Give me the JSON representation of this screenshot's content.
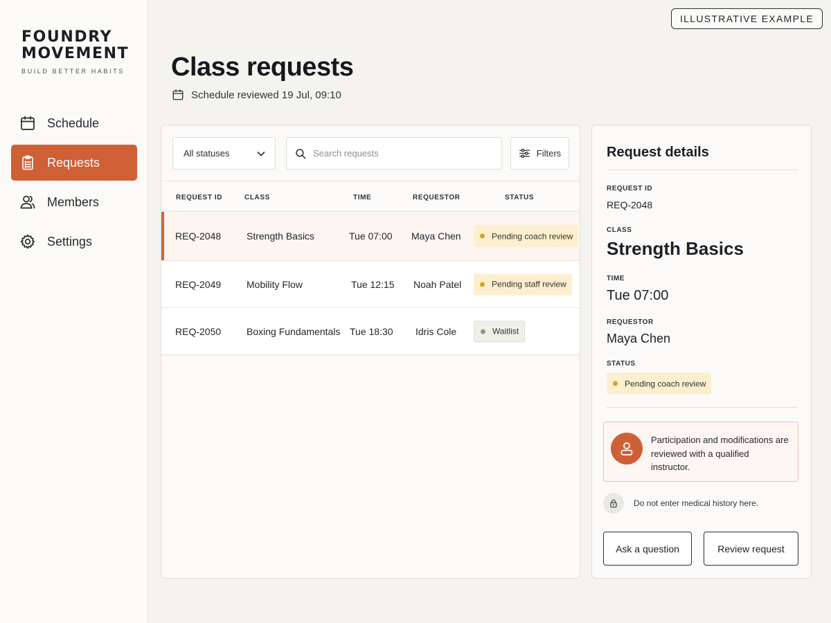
{
  "badge": "ILLUSTRATIVE EXAMPLE",
  "brand": {
    "line1": "FOUNDRY",
    "line2": "MOVEMENT",
    "tagline": "BUILD BETTER HABITS"
  },
  "nav": [
    {
      "label": "Schedule",
      "icon": "calendar-icon"
    },
    {
      "label": "Requests",
      "icon": "clipboard-icon",
      "active": true
    },
    {
      "label": "Members",
      "icon": "users-icon"
    },
    {
      "label": "Settings",
      "icon": "gear-icon"
    }
  ],
  "header": {
    "title": "Class requests",
    "reviewed": "Schedule reviewed 19 Jul, 09:10"
  },
  "toolbar": {
    "status_select": "All statuses",
    "search_placeholder": "Search requests",
    "filters_label": "Filters"
  },
  "table": {
    "columns": [
      "REQUEST ID",
      "CLASS",
      "TIME",
      "REQUESTOR",
      "STATUS"
    ],
    "rows": [
      {
        "id": "REQ-2048",
        "class": "Strength Basics",
        "time": "Tue 07:00",
        "requestor": "Maya Chen",
        "status": "Pending coach review"
      },
      {
        "id": "REQ-2049",
        "class": "Mobility Flow",
        "time": "Tue 12:15",
        "requestor": "Noah Patel",
        "status": "Pending staff review"
      },
      {
        "id": "REQ-2050",
        "class": "Boxing Fundamentals",
        "time": "Tue 18:30",
        "requestor": "Idris Cole",
        "status": "Waitlist"
      }
    ]
  },
  "details": {
    "title": "Request details",
    "request_id_label": "REQUEST ID",
    "request_id": "REQ-2048",
    "class_label": "CLASS",
    "class": "Strength Basics",
    "time_label": "TIME",
    "time": "Tue 07:00",
    "requestor_label": "REQUESTOR",
    "requestor": "Maya Chen",
    "status_label": "STATUS",
    "status": "Pending coach review",
    "notice": "Participation and modifications are reviewed with a qualified instructor.",
    "privacy": "Do not enter medical history here.",
    "ask_button": "Ask a question",
    "review_button": "Review request"
  },
  "colors": {
    "accent": "#cf5f35",
    "pending_bg": "#fcefcf",
    "pending_dot": "#d8a12c",
    "waitlist_bg": "#eef0e8",
    "waitlist_dot": "#8a9a77"
  }
}
